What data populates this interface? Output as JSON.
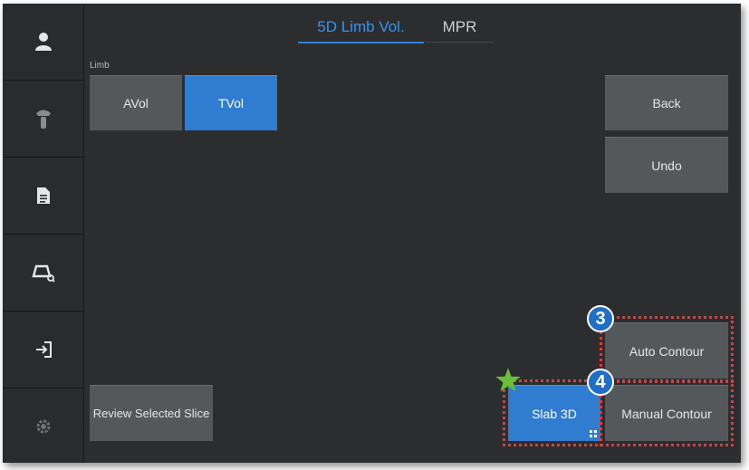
{
  "sidebar": {
    "items": [
      {
        "icon": "person-icon"
      },
      {
        "icon": "probe-icon"
      },
      {
        "icon": "document-icon"
      },
      {
        "icon": "image-search-icon"
      },
      {
        "icon": "exit-icon"
      },
      {
        "icon": "settings-gear-icon"
      }
    ]
  },
  "tabs": [
    {
      "label": "5D Limb Vol.",
      "active": true
    },
    {
      "label": "MPR",
      "active": false
    }
  ],
  "limb": {
    "label": "Limb",
    "options": [
      {
        "label": "AVol",
        "selected": false
      },
      {
        "label": "TVol",
        "selected": true
      }
    ]
  },
  "actions": {
    "back": "Back",
    "undo": "Undo",
    "review_selected_slice": "Review Selected Slice",
    "slab_3d": "Slab 3D",
    "auto_contour": "Auto Contour",
    "manual_contour": "Manual Contour"
  },
  "annotations": {
    "badge_auto_contour": "3",
    "badge_manual_contour": "4"
  },
  "colors": {
    "accent": "#2f7cd0",
    "highlight": "#e53935",
    "star": "#6abf3a"
  }
}
